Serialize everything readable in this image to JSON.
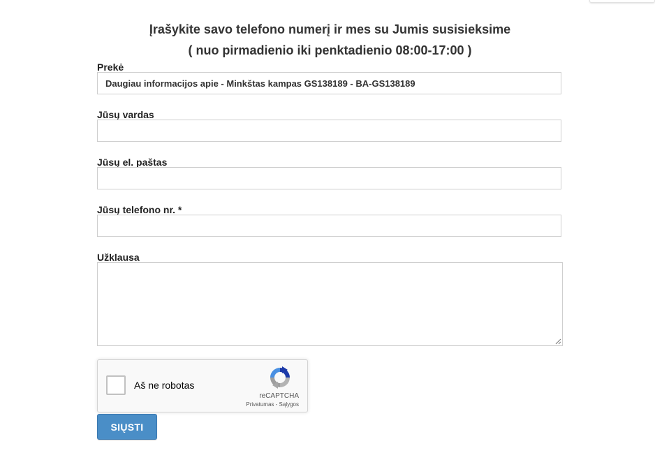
{
  "heading": {
    "line1": "Įrašykite savo telefono numerį ir mes su Jumis susisieksime",
    "line2": "( nuo pirmadienio iki penktadienio 08:00-17:00 )"
  },
  "form": {
    "product": {
      "label": "Prekė",
      "value": "Daugiau informacijos apie - Minkštas kampas GS138189 - BA-GS138189"
    },
    "name": {
      "label": "Jūsų vardas",
      "value": ""
    },
    "email": {
      "label": "Jūsų el. paštas",
      "value": ""
    },
    "phone": {
      "label": "Jūsų telefono nr. *",
      "value": ""
    },
    "inquiry": {
      "label": "Užklausa",
      "value": ""
    },
    "submit_label": "SIŲSTI"
  },
  "recaptcha": {
    "checkbox_label": "Aš ne robotas",
    "brand": "reCAPTCHA",
    "privacy_link": "Privatumas",
    "separator": " - ",
    "terms_link": "Sąlygos",
    "icon": "recaptcha-logo-icon",
    "checked": false
  },
  "colors": {
    "button_bg": "#4a8ec7",
    "input_border": "#cfcfcf"
  }
}
